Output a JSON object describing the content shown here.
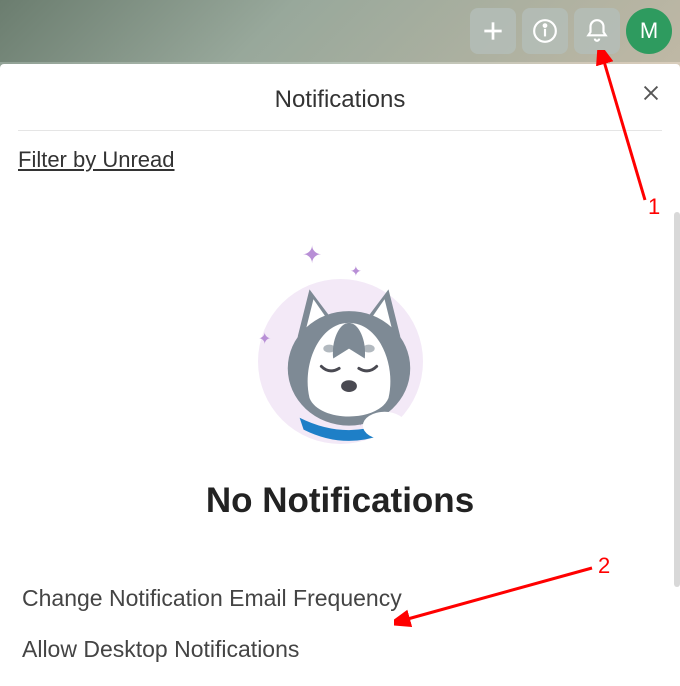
{
  "header": {
    "avatar_initial": "M"
  },
  "panel": {
    "title": "Notifications",
    "filter_label": "Filter by Unread",
    "empty_title": "No Notifications",
    "actions": {
      "change_freq": "Change Notification Email Frequency",
      "allow_desktop": "Allow Desktop Notifications"
    }
  },
  "annotations": {
    "label1": "1",
    "label2": "2"
  }
}
